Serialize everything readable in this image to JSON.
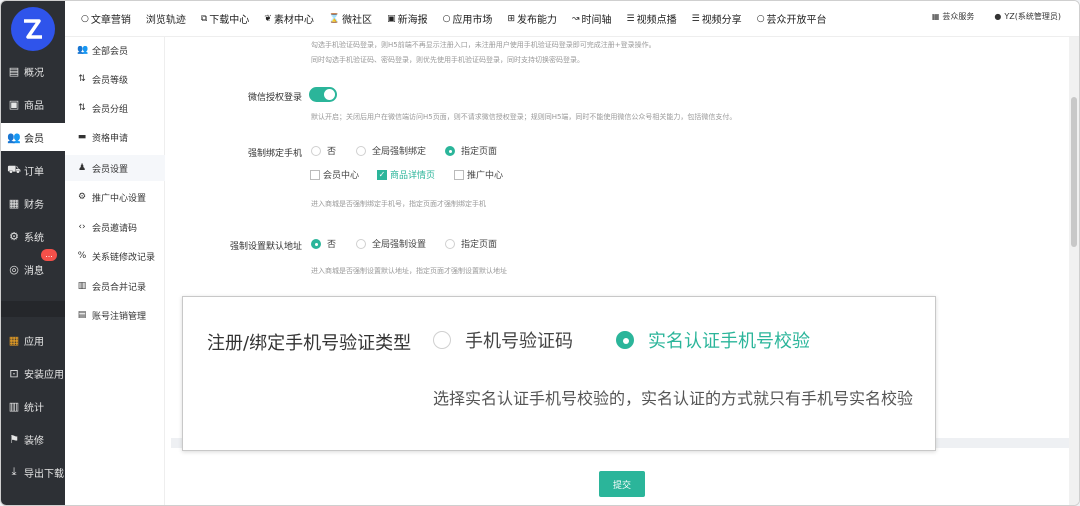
{
  "sidebar": {
    "items": [
      {
        "label": "概况",
        "icon": "chart-icon"
      },
      {
        "label": "商品",
        "icon": "box-icon"
      },
      {
        "label": "会员",
        "icon": "user-icon"
      },
      {
        "label": "订单",
        "icon": "cart-icon"
      },
      {
        "label": "财务",
        "icon": "finance-icon"
      },
      {
        "label": "系统",
        "icon": "gear-icon"
      },
      {
        "label": "消息",
        "icon": "message-icon",
        "badge": "..."
      },
      {
        "label": "应用",
        "icon": "apps-icon"
      },
      {
        "label": "安装应用",
        "icon": "install-icon"
      },
      {
        "label": "统计",
        "icon": "stats-icon"
      },
      {
        "label": "装修",
        "icon": "decorate-icon"
      },
      {
        "label": "导出下载",
        "icon": "download-icon"
      }
    ]
  },
  "topnav": {
    "items": [
      "文章营销",
      "浏览轨迹",
      "下载中心",
      "素材中心",
      "微社区",
      "新海报",
      "应用市场",
      "发布能力",
      "时间轴",
      "视频点播",
      "视频分享",
      "芸众开放平台"
    ],
    "service": "芸众服务",
    "user": "YZ(系统管理员)"
  },
  "subside": {
    "items": [
      "全部会员",
      "会员等级",
      "会员分组",
      "资格申请",
      "会员设置",
      "推广中心设置",
      "会员邀请码",
      "关系链修改记录",
      "会员合并记录",
      "账号注销管理"
    ]
  },
  "form": {
    "hint_top1": "勾选手机验证码登录，则H5前端不再显示注册入口，未注册用户使用手机验证码登录即可完成注册+登录操作。",
    "hint_top2": "同时勾选手机验证码、密码登录，则优先使用手机验证码登录，同时支持切换密码登录。",
    "wechat_label": "微信授权登录",
    "wechat_hint": "默认开启；关闭后用户在微信端访问H5页面，则不请求微信授权登录；规则同H5端，同时不能使用微信公众号相关能力，包括微信支付。",
    "bind_phone_label": "强制绑定手机",
    "bind_phone_options": [
      "否",
      "全局强制绑定",
      "指定页面"
    ],
    "page_checks": [
      "会员中心",
      "商品详情页",
      "推广中心"
    ],
    "bind_phone_hint": "进入商城是否强制绑定手机号，指定页面才强制绑定手机",
    "address_label": "强制设置默认地址",
    "address_options": [
      "否",
      "全局强制设置",
      "指定页面"
    ],
    "address_hint": "进入商城是否强制设置默认地址，指定页面才强制设置默认地址",
    "submit": "提交"
  },
  "zoom": {
    "label": "注册/绑定手机号验证类型",
    "options": [
      "手机号验证码",
      "实名认证手机号校验"
    ],
    "hint": "选择实名认证手机号校验的，实名认证的方式就只有手机号实名校验"
  },
  "colors": {
    "accent": "#2bb59a",
    "sidebar": "#2d3035",
    "logo": "#2f54eb"
  }
}
